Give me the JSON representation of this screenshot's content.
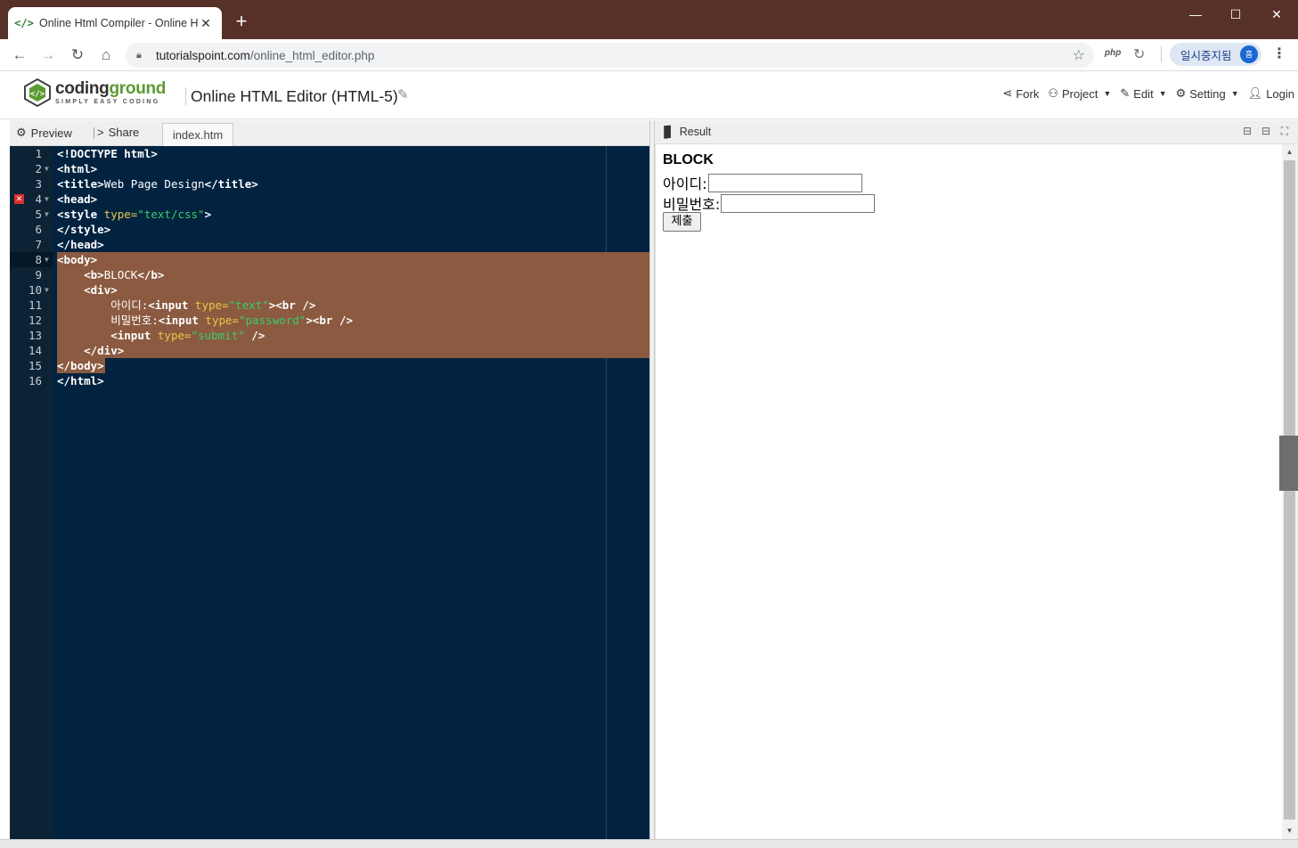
{
  "browser": {
    "tab_title": "Online Html Compiler - Online H",
    "tab_close": "✕",
    "new_tab": "+",
    "url_host": "tutorialspoint.com",
    "url_path": "/online_html_editor.php",
    "ext_php": "php",
    "profile_label": "일시중지됨",
    "profile_avatar": "흠",
    "window_controls": [
      "—",
      "☐",
      "✕"
    ]
  },
  "site": {
    "logo_title_a": "coding",
    "logo_title_b": "ground",
    "logo_subtitle": "SIMPLY EASY CODING",
    "page_title": "Online HTML Editor (HTML-5)",
    "nav": [
      {
        "label": "Fork",
        "icon": "fork-icon",
        "caret": false
      },
      {
        "label": "Project",
        "icon": "project-icon",
        "caret": true
      },
      {
        "label": "Edit",
        "icon": "edit-icon",
        "caret": true
      },
      {
        "label": "Setting",
        "icon": "gear-icon",
        "caret": true
      },
      {
        "label": "Login",
        "icon": "user-icon",
        "caret": false
      }
    ]
  },
  "editor": {
    "preview_label": "Preview",
    "share_label": "Share",
    "file_tab": "index.htm",
    "lines": [
      {
        "n": "1",
        "fold": false,
        "html": "<span class=\"tag\">&lt;!DOCTYPE html&gt;</span>"
      },
      {
        "n": "2",
        "fold": true,
        "html": "<span class=\"tag\">&lt;html&gt;</span>"
      },
      {
        "n": "3",
        "fold": false,
        "html": "<span class=\"tag\">&lt;title&gt;</span>Web Page Design<span class=\"tag\">&lt;/title&gt;</span>"
      },
      {
        "n": "4",
        "fold": true,
        "html": "<span class=\"tag\">&lt;head&gt;</span>"
      },
      {
        "n": "5",
        "fold": true,
        "html": "<span class=\"tag\">&lt;style </span><span class=\"attr\">type=</span><span class=\"str\">\"text/css\"</span><span class=\"tag\">&gt;</span>"
      },
      {
        "n": "6",
        "fold": false,
        "html": "<span class=\"tag\">&lt;/style&gt;</span>"
      },
      {
        "n": "7",
        "fold": false,
        "html": "<span class=\"tag\">&lt;/head&gt;</span>"
      },
      {
        "n": "8",
        "fold": true,
        "html": "<span class=\"tag\">&lt;body&gt;</span>"
      },
      {
        "n": "9",
        "fold": false,
        "html": "    <span class=\"tag\">&lt;b&gt;</span>BLOCK<span class=\"tag\">&lt;/b&gt;</span>"
      },
      {
        "n": "10",
        "fold": true,
        "html": "    <span class=\"tag\">&lt;div&gt;</span>"
      },
      {
        "n": "11",
        "fold": false,
        "html": "        아이디:<span class=\"tag\">&lt;input </span><span class=\"attr\">type=</span><span class=\"str\">\"text\"</span><span class=\"tag\">&gt;&lt;br /&gt;</span>"
      },
      {
        "n": "12",
        "fold": false,
        "html": "        비밀번호:<span class=\"tag\">&lt;input </span><span class=\"attr\">type=</span><span class=\"str\">\"password\"</span><span class=\"tag\">&gt;&lt;br /&gt;</span>"
      },
      {
        "n": "13",
        "fold": false,
        "html": "        <span class=\"tag\">&lt;input </span><span class=\"attr\">type=</span><span class=\"str\">\"submit\"</span><span class=\"tag\"> /&gt;</span>"
      },
      {
        "n": "14",
        "fold": false,
        "html": "    <span class=\"tag\">&lt;/div&gt;</span>"
      },
      {
        "n": "15",
        "fold": false,
        "html": "<span class=\"tag\">&lt;/body&gt;</span>"
      },
      {
        "n": "16",
        "fold": false,
        "html": "<span class=\"tag\">&lt;/html&gt;</span>"
      }
    ]
  },
  "result": {
    "label": "Result",
    "block_text": "BLOCK",
    "id_label": "아이디:",
    "pw_label": "비밀번호:",
    "submit_label": "제출"
  }
}
